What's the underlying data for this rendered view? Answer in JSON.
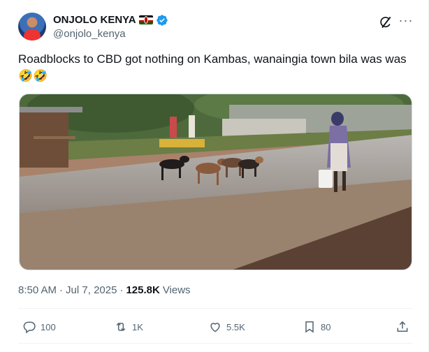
{
  "author": {
    "display_name": "ONJOLO KENYA",
    "flag_icon": "kenya-flag-icon",
    "verified_icon": "verified-badge-icon",
    "handle": "@onjolo_kenya"
  },
  "header_actions": {
    "grok_icon": "grok-icon",
    "more_icon": "more-horizontal-icon",
    "more_label": "···"
  },
  "tweet": {
    "text": "Roadblocks to CBD got nothing on Kambas, wanaingia town bila was was 🤣🤣"
  },
  "meta": {
    "time": "8:50 AM",
    "separator1": "·",
    "date": "Jul 7, 2025",
    "separator2": "·",
    "views_count": "125.8K",
    "views_label": "Views"
  },
  "actions": {
    "reply": {
      "icon": "reply-icon",
      "count": "100"
    },
    "retweet": {
      "icon": "retweet-icon",
      "count": "1K"
    },
    "like": {
      "icon": "heart-icon",
      "count": "5.5K"
    },
    "bookmark": {
      "icon": "bookmark-icon",
      "count": "80"
    },
    "share": {
      "icon": "share-icon"
    }
  },
  "colors": {
    "text_primary": "#0f1419",
    "text_secondary": "#536471",
    "verified_blue": "#1d9bf0",
    "divider": "#eff3f4"
  }
}
